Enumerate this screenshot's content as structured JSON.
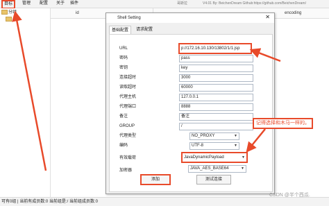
{
  "menubar": {
    "items": [
      "目标",
      "管理",
      "配置",
      "关于",
      "插件"
    ],
    "title_right": "哥斯拉",
    "version_text": "V4.01 By: BeichenDream Github:https://github.com/BeichenDream/"
  },
  "tree": {
    "root": "分组",
    "child": "/"
  },
  "table": {
    "col_id": "id",
    "col_encoding": "encoding"
  },
  "dialog": {
    "title": "Shell Setting",
    "tabs": [
      "基础配置",
      "请求配置"
    ],
    "fields": {
      "url": {
        "label": "URL",
        "value": "p://172.16.10.130/13802/1/1.jsp"
      },
      "password": {
        "label": "密码",
        "value": "pass"
      },
      "key": {
        "label": "密钥",
        "value": "key"
      },
      "conn_timeout": {
        "label": "连接超时",
        "value": "3000"
      },
      "read_timeout": {
        "label": "读取超时",
        "value": "60000"
      },
      "proxy_host": {
        "label": "代理主机",
        "value": "127.0.0.1"
      },
      "proxy_port": {
        "label": "代理端口",
        "value": "8888"
      },
      "remark": {
        "label": "备注",
        "value": "备注"
      },
      "group": {
        "label": "GROUP",
        "value": "/"
      }
    },
    "selects": {
      "proxy_type": {
        "label": "代理类型",
        "value": "NO_PROXY"
      },
      "encoding": {
        "label": "编码",
        "value": "UTF-8"
      },
      "payload": {
        "label": "有效载荷",
        "value": "JavaDynamicPayload"
      },
      "crypto": {
        "label": "加密器",
        "value": "JAVA_AES_BASE64"
      }
    },
    "buttons": {
      "add": "添加",
      "test": "测试连接"
    }
  },
  "annotation": {
    "note": "记得选择和木马一样的。"
  },
  "statusbar": {
    "text": "可有0组 | 当前有成员数:0 当前组是:/ 当前组成员数:0"
  },
  "watermark": "CSDN @半个西瓜.",
  "colors": {
    "highlight": "#e84a2a",
    "folder": "#e9c46a"
  }
}
